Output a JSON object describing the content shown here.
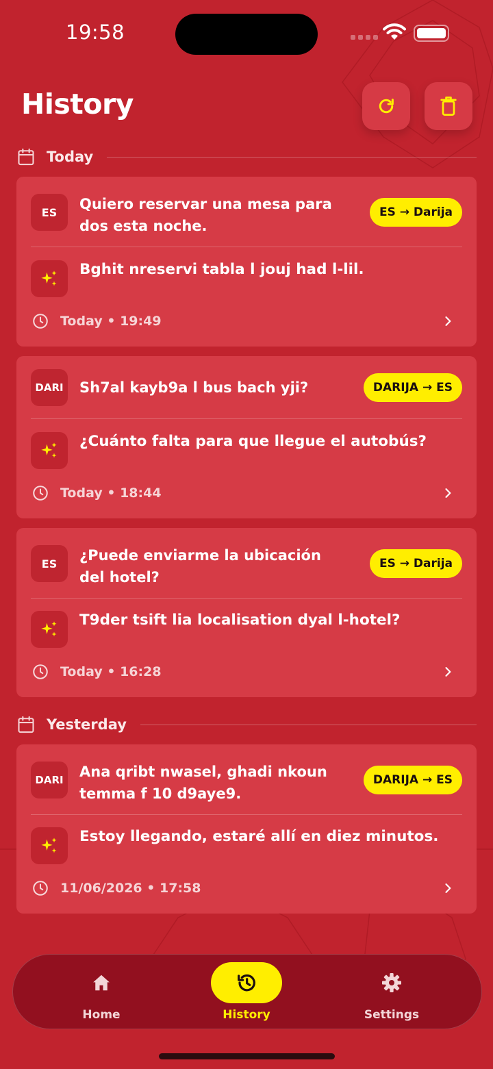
{
  "status_bar": {
    "time": "19:58"
  },
  "header": {
    "title": "History",
    "refresh_icon": "refresh-icon",
    "trash_icon": "trash-icon"
  },
  "colors": {
    "background": "#c1232e",
    "card": "#d63b46",
    "accent": "#ffee00",
    "nav": "#92101f"
  },
  "sections": [
    {
      "label": "Today"
    },
    {
      "label": "Yesterday"
    }
  ],
  "entries": [
    {
      "source_lang": "ES",
      "source_text": "Quiero reservar una mesa para dos esta noche.",
      "direction": "ES → Darija",
      "translation": "Bghit nreservi tabla l jouj had l-lil.",
      "timestamp": "Today • 19:49"
    },
    {
      "source_lang": "DARI",
      "source_text": "Sh7al kayb9a l bus bach yji?",
      "direction": "DARIJA → ES",
      "translation": "¿Cuánto falta para que llegue el autobús?",
      "timestamp": "Today • 18:44"
    },
    {
      "source_lang": "ES",
      "source_text": "¿Puede enviarme la ubicación del hotel?",
      "direction": "ES → Darija",
      "translation": "T9der tsift lia localisation dyal l-hotel?",
      "timestamp": "Today • 16:28"
    },
    {
      "source_lang": "DARI",
      "source_text": "Ana qribt nwasel, ghadi nkoun temma f 10 d9aye9.",
      "direction": "DARIJA → ES",
      "translation": "Estoy llegando, estaré allí en diez minutos.",
      "timestamp": "11/06/2026 • 17:58"
    }
  ],
  "nav": {
    "items": [
      {
        "label": "Home",
        "icon": "home-icon"
      },
      {
        "label": "History",
        "icon": "history-icon",
        "active": true
      },
      {
        "label": "Settings",
        "icon": "gear-icon"
      }
    ]
  }
}
